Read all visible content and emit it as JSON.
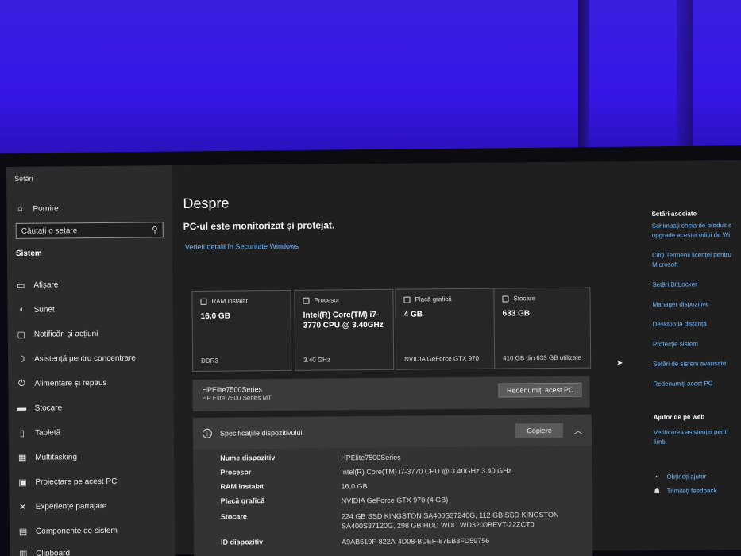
{
  "window": {
    "title": "Setări"
  },
  "sidebar": {
    "home": "Pornire",
    "search_placeholder": "Căutați o setare",
    "section": "Sistem",
    "items": [
      {
        "icon": "display-icon",
        "label": "Afișare"
      },
      {
        "icon": "sound-icon",
        "label": "Sunet"
      },
      {
        "icon": "notifications-icon",
        "label": "Notificări și acțiuni"
      },
      {
        "icon": "focus-assist-icon",
        "label": "Asistență pentru concentrare"
      },
      {
        "icon": "power-icon",
        "label": "Alimentare și repaus"
      },
      {
        "icon": "storage-icon",
        "label": "Stocare"
      },
      {
        "icon": "tablet-icon",
        "label": "Tabletă"
      },
      {
        "icon": "multitasking-icon",
        "label": "Multitasking"
      },
      {
        "icon": "projecting-icon",
        "label": "Proiectare pe acest PC"
      },
      {
        "icon": "shared-experiences-icon",
        "label": "Experiențe partajate"
      },
      {
        "icon": "system-components-icon",
        "label": "Componente de sistem"
      },
      {
        "icon": "clipboard-icon",
        "label": "Clipboard"
      }
    ]
  },
  "main": {
    "title": "Despre",
    "protection": "PC-ul este monitorizat și protejat.",
    "security_link": "Vedeți detalii în Securitate Windows",
    "cards": [
      {
        "icon": "ram-icon",
        "title": "RAM instalat",
        "value": "16,0 GB",
        "foot": "DDR3"
      },
      {
        "icon": "processor-icon",
        "title": "Procesor",
        "value": "Intel(R) Core(TM) i7-3770 CPU @ 3.40GHz",
        "foot": "3.40 GHz"
      },
      {
        "icon": "gpu-icon",
        "title": "Placă grafică",
        "value": "4 GB",
        "foot": "NVIDIA GeForce GTX 970"
      },
      {
        "icon": "storage-card-icon",
        "title": "Stocare",
        "value": "633 GB",
        "foot": "410 GB din 633 GB utilizate"
      }
    ],
    "pc": {
      "name": "HPElite7500Series",
      "model": "HP Elite 7500 Series MT",
      "rename": "Redenumiți acest PC"
    },
    "specs": {
      "title": "Specificațiile dispozitivului",
      "copy": "Copiere",
      "rows": [
        {
          "key": "Nume dispozitiv",
          "value": "HPElite7500Series"
        },
        {
          "key": "Procesor",
          "value": "Intel(R) Core(TM) i7-3770 CPU @ 3.40GHz   3.40 GHz"
        },
        {
          "key": "RAM instalat",
          "value": "16,0 GB"
        },
        {
          "key": "Placă grafică",
          "value": "NVIDIA GeForce GTX 970 (4 GB)"
        },
        {
          "key": "Stocare",
          "value": "224 GB SSD KINGSTON SA400S37240G, 112 GB SSD KINGSTON SA400S37120G, 298 GB HDD WDC WD3200BEVT-22ZCT0"
        },
        {
          "key": "ID dispozitiv",
          "value": "A9AB619F-822A-4D08-BDEF-87EB3FD59756"
        }
      ]
    }
  },
  "right": {
    "related_head": "Setări asociate",
    "links": [
      "Schimbați cheia de produs s",
      "upgrade acestei ediții de Wi",
      "Citiți Termenii licenței pentru",
      "Microsoft",
      "Setări BitLocker",
      "Manager dispozitive",
      "Desktop la distanță",
      "Protecție sistem",
      "Setări de sistem avansate",
      "Redenumiți acest PC"
    ],
    "help_head": "Ajutor de pe web",
    "help_links": [
      "Verificarea asistenței pentr",
      "limbi"
    ],
    "support": "Obțineți ajutor",
    "feedback": "Trimiteți feedback"
  }
}
